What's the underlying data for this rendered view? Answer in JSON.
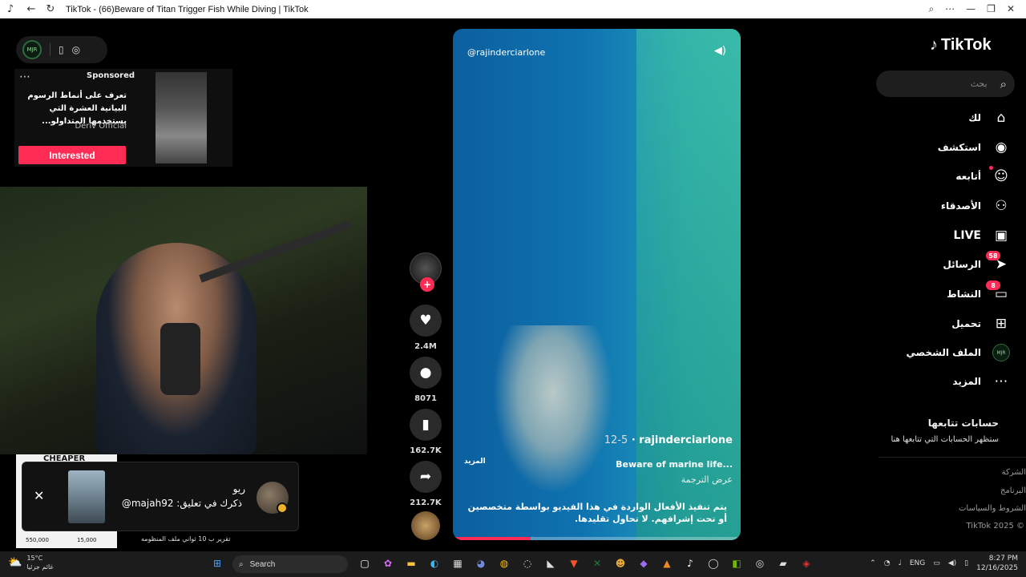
{
  "browser": {
    "title": "TikTok - (66)Beware of Titan Trigger Fish While Diving | TikTok",
    "icons": [
      "tiktok-app-icon",
      "back-arrow-icon",
      "reload-icon",
      "zoom-icon",
      "more-icon",
      "minimize-icon",
      "maximize-icon",
      "close-icon"
    ]
  },
  "overlay": {
    "logo_text": "MJR",
    "sponsored_label": "Sponsored",
    "ad_text": "تعرف على أنماط الرسوم البيانية العشرة التي يستخدمها المتداولو...",
    "ad_brand": "Deriv Official",
    "interested_label": "Interested"
  },
  "notification": {
    "ad_title": "CHEAPER",
    "price1": "550,000",
    "price2": "15,000",
    "name": "ريو",
    "text": "ذكرك في تعليق: majah92@",
    "below_text": "تقرير ب 10 ثواني ملف المنظومه"
  },
  "video": {
    "handle": "@rajinderciarlone",
    "username": "rajinderciarlone",
    "date": "12-5",
    "caption": "Beware of marine life...",
    "translate": "عرض الترجمة",
    "more": "المزيد",
    "warning": "يتم تنفيذ الأفعال الواردة في هذا الفيديو بواسطة متخصصين أو تحت إشرافهم. لا تحاول تقليدها.",
    "progress": 0.27
  },
  "actions": {
    "likes": "2.4M",
    "comments": "8071",
    "saves": "162.7K",
    "shares": "212.7K"
  },
  "sidebar": {
    "logo": "TikTok",
    "search_placeholder": "بحث",
    "nav": [
      {
        "label": "لك",
        "icon": "home-icon"
      },
      {
        "label": "استكشف",
        "icon": "compass-icon"
      },
      {
        "label": "أتابعه",
        "icon": "user-follow-icon"
      },
      {
        "label": "الأصدقاء",
        "icon": "friends-icon"
      },
      {
        "label": "LIVE",
        "icon": "live-tv-icon"
      },
      {
        "label": "الرسائل",
        "icon": "send-icon",
        "badge": "58"
      },
      {
        "label": "النشاط",
        "icon": "activity-icon",
        "badge": "8"
      },
      {
        "label": "تحميل",
        "icon": "upload-icon"
      },
      {
        "label": "الملف الشخصي",
        "icon": "avatar-icon"
      },
      {
        "label": "المزيد",
        "icon": "more-dots-icon"
      }
    ],
    "following_heading": "حسابات تتابعها",
    "following_sub": "ستظهر الحسابات التي تتابعها هنا",
    "footer": [
      "الشركة",
      "البرنامج",
      "الشروط والسياسات",
      "TikTok 2025 ©"
    ]
  },
  "taskbar": {
    "temperature": "15°C",
    "weather_text": "غائم جزئيا",
    "search_label": "Search",
    "lang": "ENG",
    "time": "8:27 PM",
    "date": "12/16/2025"
  },
  "colors": {
    "accent": "#fe2c55",
    "background": "#000000"
  }
}
